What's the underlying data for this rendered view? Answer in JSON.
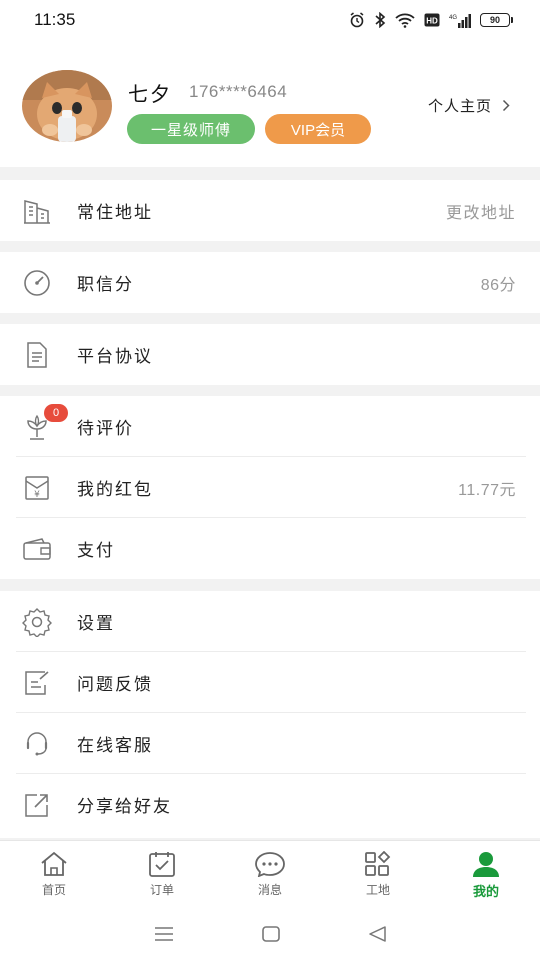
{
  "status_bar": {
    "time": "11:35",
    "battery": "90"
  },
  "profile": {
    "name": "七夕",
    "phone": "176****6464",
    "level_badge": "一星级师傅",
    "vip_badge": "VIP会员",
    "homepage_link": "个人主页"
  },
  "menu": {
    "address": {
      "label": "常住地址",
      "value": "更改地址"
    },
    "credit": {
      "label": "职信分",
      "value": "86分"
    },
    "agreement": {
      "label": "平台协议"
    },
    "pending_review": {
      "label": "待评价",
      "badge": "0"
    },
    "red_packet": {
      "label": "我的红包",
      "value": "11.77元"
    },
    "payment": {
      "label": "支付"
    },
    "settings": {
      "label": "设置"
    },
    "feedback": {
      "label": "问题反馈"
    },
    "support": {
      "label": "在线客服"
    },
    "share": {
      "label": "分享给好友"
    }
  },
  "tabs": [
    {
      "label": "首页",
      "icon": "home-icon"
    },
    {
      "label": "订单",
      "icon": "order-icon"
    },
    {
      "label": "消息",
      "icon": "message-icon"
    },
    {
      "label": "工地",
      "icon": "worksite-icon"
    },
    {
      "label": "我的",
      "icon": "profile-icon",
      "active": true
    }
  ],
  "colors": {
    "accent_green": "#1a9a3b",
    "badge_green": "#6bbf6e",
    "badge_orange": "#ef9a4a",
    "notif_red": "#e74c3c"
  }
}
